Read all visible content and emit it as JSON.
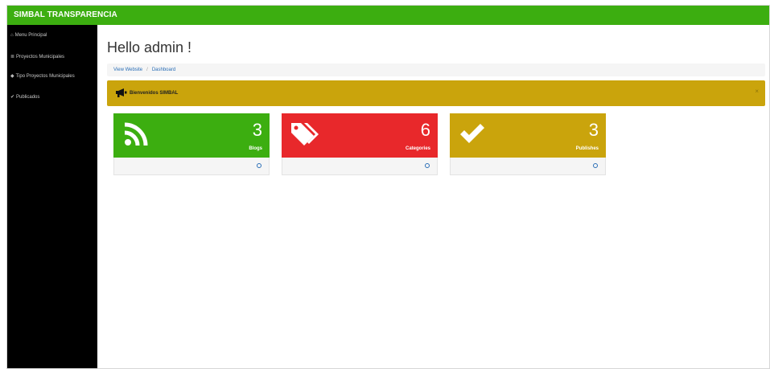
{
  "brand": "SIMBAL TRANSPARENCIA",
  "sidebar": {
    "items": [
      {
        "icon": "home-icon",
        "label": "Menu Principal"
      },
      {
        "icon": "list-icon",
        "label": "Proyectos Municipales"
      },
      {
        "icon": "tag-icon",
        "label": "Tipo Proyectos Municipales"
      },
      {
        "icon": "check-icon",
        "label": "Publicados"
      }
    ]
  },
  "main": {
    "title": "Hello admin !",
    "breadcrumb": [
      "View Website",
      "Dashboard"
    ],
    "alert": {
      "icon": "bullhorn-icon",
      "message": "Bienvenidos SIMBAL",
      "close": "×"
    },
    "cards": [
      {
        "icon": "rss-icon",
        "count": "3",
        "label": "Blogs",
        "color": "#3cae10"
      },
      {
        "icon": "tags-icon",
        "count": "6",
        "label": "Categories",
        "color": "#e8282b"
      },
      {
        "icon": "check-icon",
        "count": "3",
        "label": "Publishes",
        "color": "#caa40c"
      }
    ]
  },
  "colors": {
    "accent_green": "#3cae10",
    "danger_red": "#e8282b",
    "warning_gold": "#caa40c",
    "sidebar": "#000000"
  }
}
